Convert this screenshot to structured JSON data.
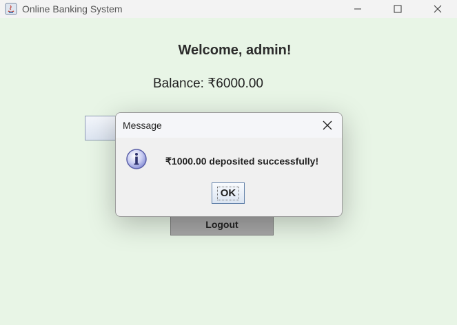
{
  "window": {
    "title": "Online Banking System",
    "controls": [
      "minimize-icon",
      "maximize-icon",
      "close-icon"
    ]
  },
  "main": {
    "welcome": "Welcome, admin!",
    "balance": "Balance: ₹6000.00",
    "logout_label": "Logout"
  },
  "dialog": {
    "title": "Message",
    "icon": "info-icon",
    "message": "₹1000.00 deposited successfully!",
    "ok_label": "OK"
  },
  "colors": {
    "background": "#e8f5e6",
    "logout_button": "#a7a7a7",
    "dialog_bg": "#f0f0f0"
  }
}
